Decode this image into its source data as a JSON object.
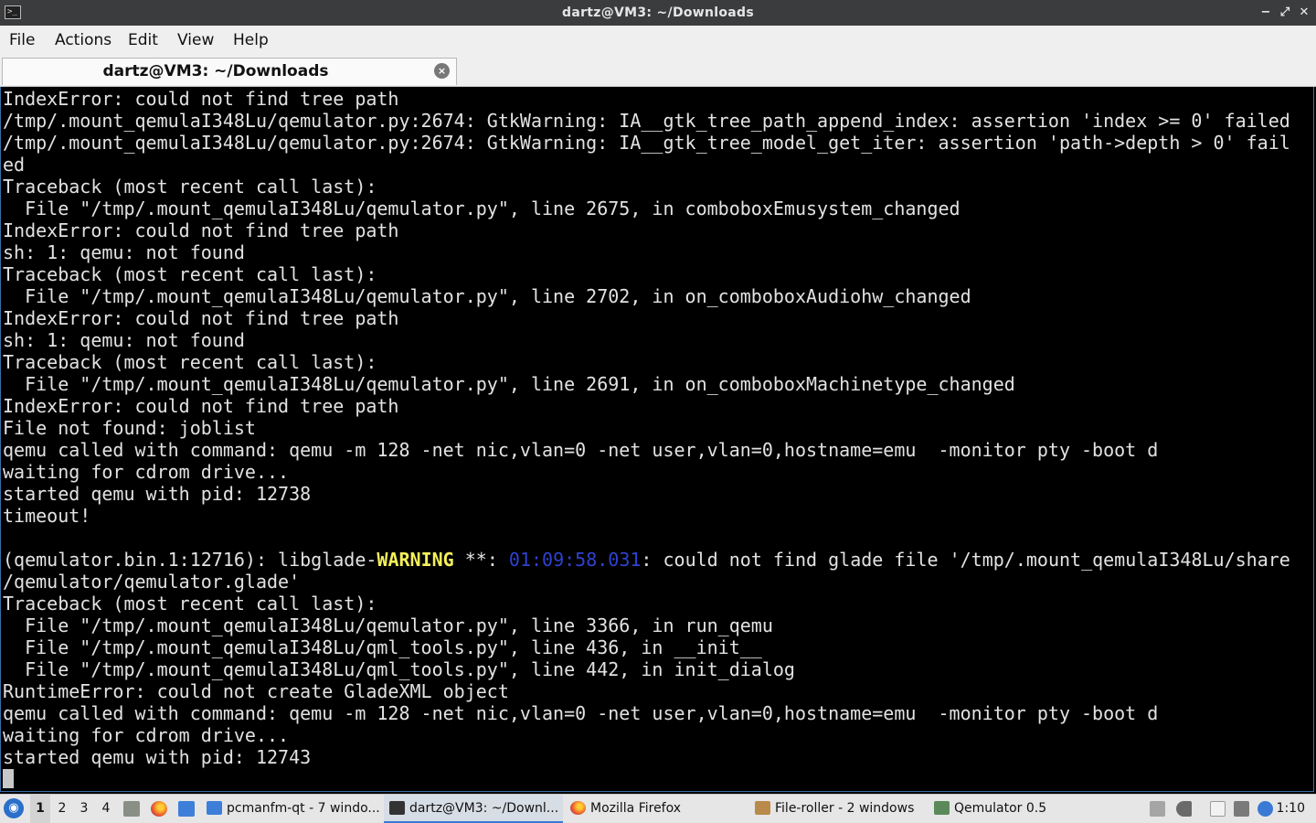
{
  "window": {
    "title": "dartz@VM3: ~/Downloads",
    "app_icon": ">_",
    "controls": {
      "minimize": "−",
      "maximize": "⤢",
      "close": "✕"
    }
  },
  "menu": [
    "File",
    "Actions",
    "Edit",
    "View",
    "Help"
  ],
  "tab": {
    "label": "dartz@VM3: ~/Downloads",
    "close": "×"
  },
  "terminal": {
    "lines": [
      "IndexError: could not find tree path",
      "/tmp/.mount_qemulaI348Lu/qemulator.py:2674: GtkWarning: IA__gtk_tree_path_append_index: assertion 'index >= 0' failed",
      "/tmp/.mount_qemulaI348Lu/qemulator.py:2674: GtkWarning: IA__gtk_tree_model_get_iter: assertion 'path->depth > 0' fail",
      "ed",
      "Traceback (most recent call last):",
      "  File \"/tmp/.mount_qemulaI348Lu/qemulator.py\", line 2675, in comboboxEmusystem_changed",
      "IndexError: could not find tree path",
      "sh: 1: qemu: not found",
      "Traceback (most recent call last):",
      "  File \"/tmp/.mount_qemulaI348Lu/qemulator.py\", line 2702, in on_comboboxAudiohw_changed",
      "IndexError: could not find tree path",
      "sh: 1: qemu: not found",
      "Traceback (most recent call last):",
      "  File \"/tmp/.mount_qemulaI348Lu/qemulator.py\", line 2691, in on_comboboxMachinetype_changed",
      "IndexError: could not find tree path",
      "File not found: joblist",
      "qemu called with command: qemu -m 128 -net nic,vlan=0 -net user,vlan=0,hostname=emu  -monitor pty -boot d",
      "waiting for cdrom drive...",
      "started qemu with pid: 12738",
      "timeout!",
      ""
    ],
    "warning_line": {
      "prefix": "(qemulator.bin.1:12716): libglade-",
      "level": "WARNING",
      "sep": " **: ",
      "timestamp": "01:09:58.031",
      "message": ": could not find glade file '/tmp/.mount_qemulaI348Lu/share"
    },
    "lines_after": [
      "/qemulator/qemulator.glade'",
      "Traceback (most recent call last):",
      "  File \"/tmp/.mount_qemulaI348Lu/qemulator.py\", line 3366, in run_qemu",
      "  File \"/tmp/.mount_qemulaI348Lu/qml_tools.py\", line 436, in __init__",
      "  File \"/tmp/.mount_qemulaI348Lu/qml_tools.py\", line 442, in init_dialog",
      "RuntimeError: could not create GladeXML object",
      "qemu called with command: qemu -m 128 -net nic,vlan=0 -net user,vlan=0,hostname=emu  -monitor pty -boot d",
      "waiting for cdrom drive...",
      "started qemu with pid: 12743"
    ]
  },
  "taskbar": {
    "desktops": [
      "1",
      "2",
      "3",
      "4"
    ],
    "tasks": [
      {
        "label": "pcmanfm-qt - 7 windo...",
        "icon": "folder-icon",
        "color": "#3d7fd8"
      },
      {
        "label": "dartz@VM3: ~/Downl...",
        "icon": "terminal-icon",
        "color": "#333333"
      },
      {
        "label": "Mozilla Firefox",
        "icon": "firefox-icon",
        "color": "#e8572a"
      },
      {
        "label": "File-roller - 2 windows",
        "icon": "archive-icon",
        "color": "#b98a4a"
      },
      {
        "label": "Qemulator 0.5",
        "icon": "qemulator-icon",
        "color": "#5a8a5a"
      }
    ],
    "clock": "1:10"
  }
}
